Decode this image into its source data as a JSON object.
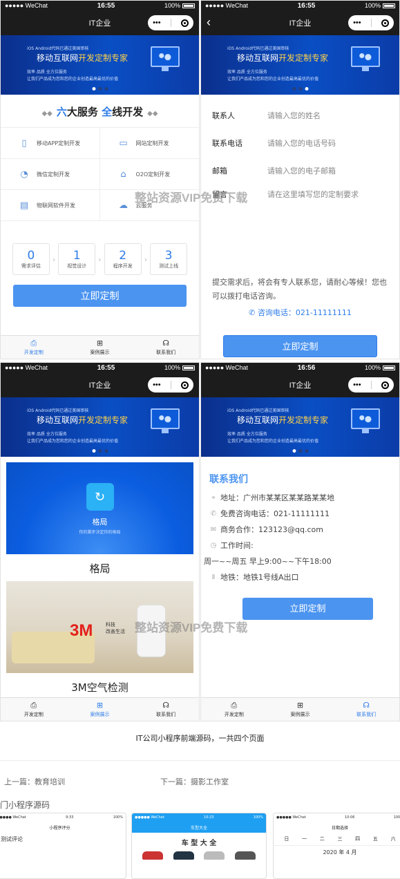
{
  "status": {
    "carrier": "●●●●● WeChat",
    "battery": "100%",
    "time1": "16:55",
    "time2": "16:55",
    "time3": "16:55",
    "time4": "16:56"
  },
  "nav": {
    "title": "IT企业",
    "capsule_more": "•••"
  },
  "banner": {
    "small": "iOS Android代码已通过美国审核",
    "big_a": "移动互联网",
    "big_b": "开发定制专家",
    "line1": "效率 品质 全方位服务",
    "line2": "让我们产品成为您和您的企业创造最高最优的价值"
  },
  "services": {
    "title_pre": "六",
    "title_mid": "大服务 ",
    "title_b": "全",
    "title_post": "线开发",
    "items": [
      {
        "icon": "phone-icon",
        "label": "移动APP定制开发"
      },
      {
        "icon": "laptop-icon",
        "label": "网站定制开发"
      },
      {
        "icon": "chat-icon",
        "label": "微信定制开发"
      },
      {
        "icon": "store-icon",
        "label": "O2O定制开发"
      },
      {
        "icon": "device-icon",
        "label": "物联网软件开发"
      },
      {
        "icon": "cloud-icon",
        "label": "云服务"
      }
    ]
  },
  "steps": [
    {
      "num": "0",
      "label": "需求评估"
    },
    {
      "num": "1",
      "label": "视觉设计"
    },
    {
      "num": "2",
      "label": "程序开发"
    },
    {
      "num": "3",
      "label": "测试上线"
    }
  ],
  "cta_label": "立即定制",
  "tabs": [
    {
      "icon": "print-icon",
      "label": "开发定制"
    },
    {
      "icon": "grid-icon",
      "label": "案例展示"
    },
    {
      "icon": "headset-icon",
      "label": "联系我们"
    }
  ],
  "form": {
    "fields": [
      {
        "label": "联系人",
        "placeholder": "请输入您的姓名"
      },
      {
        "label": "联系电话",
        "placeholder": "请输入您的电话号码"
      },
      {
        "label": "邮箱",
        "placeholder": "请输入您的电子邮箱"
      },
      {
        "label": "留言",
        "placeholder": "请在这里填写您的定制要求"
      }
    ],
    "tip": "提交需求后，将会有专人联系您，请耐心等候！您也可以拨打电话咨询。",
    "phone": "咨询电话：021-11111111"
  },
  "cases": [
    {
      "name": "格局",
      "logo_text": "格局",
      "slogan": "你的脚步决定你的格局"
    },
    {
      "name": "3M空气检测",
      "brand": "3M",
      "slogan": "科技\n改善生活"
    }
  ],
  "contact": {
    "title": "联系我们",
    "address": "地址：广州市某某区某某路某某地",
    "hotline": "免费咨询电话：021-11111111",
    "business": "商务合作：123123@qq.com",
    "hours_label": "工作时间:",
    "hours": "周一~~周五 早上9:00~~下午18:00",
    "metro": "地铁：地铁1号线A出口"
  },
  "watermark": "整站资源VIP免费下载",
  "caption": "IT公司小程序前端源码，一共四个页面",
  "prev": "上一篇：教育培训",
  "next": "下一篇：摄影工作室",
  "related": "门小程序源码",
  "thumbs": [
    {
      "time": "9:33",
      "title": "小程序评分",
      "body": "测试评论"
    },
    {
      "time": "10:23",
      "title": "车型大全",
      "body": "车 型 大 全"
    },
    {
      "time": "10:06",
      "title": "日期选择",
      "body": "2020 年 4 月"
    }
  ]
}
